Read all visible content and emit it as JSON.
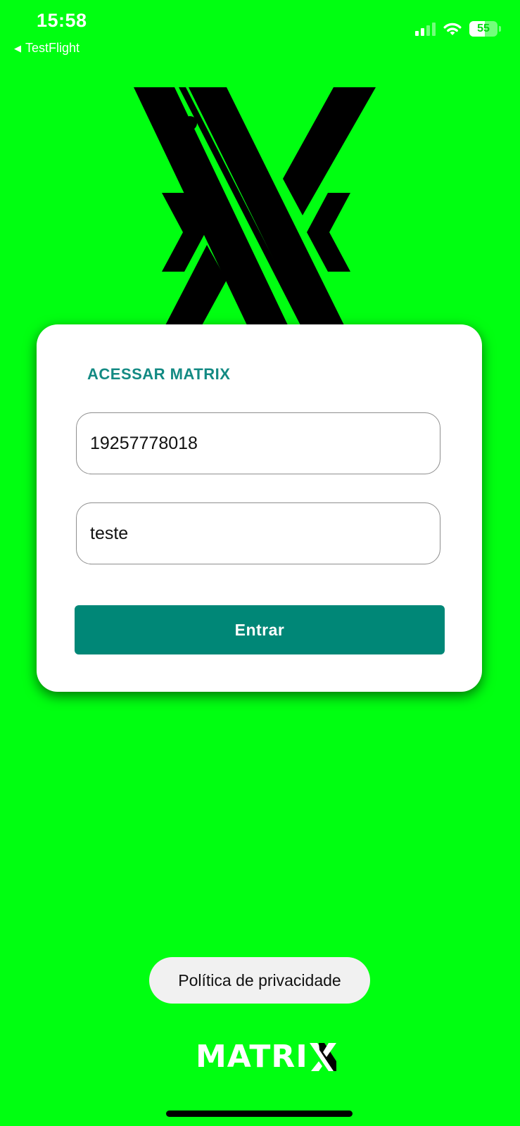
{
  "status_bar": {
    "time": "15:58",
    "back_label": "TestFlight",
    "battery": "55"
  },
  "login": {
    "title": "ACESSAR MATRIX",
    "username_value": "19257778018",
    "password_value": "teste",
    "submit_label": "Entrar"
  },
  "footer": {
    "privacy_label": "Política de privacidade",
    "brand_text": "MATRI"
  },
  "colors": {
    "background": "#00ff11",
    "accent": "#008777",
    "title": "#138a83"
  }
}
